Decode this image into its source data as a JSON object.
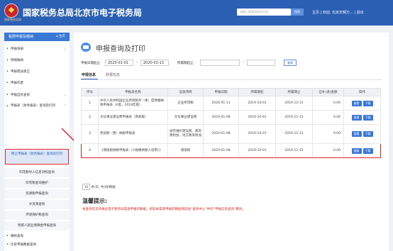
{
  "header": {
    "logo_caption": "国家税务总局",
    "site_title": "国家税务总局北京市电子税务局",
    "search_placeholder": "请输入需要搜索的内容",
    "search_button": "搜索",
    "top_links": "主页 | 欢迎, 北京天辉万... | 退出"
  },
  "sidebar": {
    "header_title": "税费申报及缴纳",
    "home_label": "主页",
    "items": [
      {
        "label": "申报清册",
        "expandable": true
      },
      {
        "label": "预填报纳",
        "expandable": false
      },
      {
        "label": "申报错误更正",
        "expandable": false
      },
      {
        "label": "申报作废",
        "expandable": false
      },
      {
        "label": "申报自有查询",
        "expandable": true
      },
      {
        "label": "申报表（财务报表）查询及打印",
        "expandable": true
      }
    ],
    "active_sub": "网上申报表（财务报表）查询及打印",
    "subs": [
      "印花税导入信息对照查询",
      "印花税查询维护",
      "资源税申报查询",
      "水资源查询",
      "环境保护税查询",
      "残疾人就业保障金申报查询"
    ],
    "bottom_items": [
      {
        "label": "缴款查询",
        "expandable": false
      },
      {
        "label": "历史申报数据查询",
        "expandable": false
      },
      {
        "label": "申报辅助报表服务",
        "expandable": true
      },
      {
        "label": "车船税",
        "expandable": true
      }
    ]
  },
  "page": {
    "title": "申报查询及打印",
    "filter": {
      "date_label": "申报日期起止:",
      "date_from": "2020-01-01",
      "date_sep": "-",
      "date_to": "2020-02-13",
      "period_label": "所属期起止:",
      "period_from": "",
      "period_to": "",
      "query_button": "查询"
    },
    "tabs": [
      "申报信息",
      "财报信息"
    ],
    "table": {
      "headers": [
        "序号",
        "申报表名称",
        "征收项目",
        "申报日期",
        "所属期起",
        "所属期止",
        "应补(退)金额",
        "操作"
      ],
      "view_label": "查看",
      "download_label": "下载",
      "rows": [
        {
          "no": "1",
          "name": "中华人民共和国企业所得税月（季）度预缴纳税申报表（A类，2018年版）",
          "item": "企业所得税",
          "date": "2020-01-11",
          "from": "2019-10-01",
          "to": "2019-12-31",
          "amount": "0.00"
        },
        {
          "no": "2",
          "name": "文化事业建设费申报表（简易版）",
          "item": "文化事业建设费",
          "date": "2020-01-08",
          "from": "2019-10-01",
          "to": "2019-12-31",
          "amount": "0.00"
        },
        {
          "no": "3",
          "name": "附加税（费）纳税申报表",
          "item": "城市维护建设税、教育费附加、地方教育附加",
          "date": "2020-01-08",
          "from": "2019-10-01",
          "to": "2019-12-31",
          "amount": "0.00"
        },
        {
          "no": "4",
          "name": "《增值税纳税申报表（小规模纳税人适用）》",
          "item": "增值税",
          "date": "2020-01-08",
          "from": "2019-10-01",
          "to": "2019-12-31",
          "amount": "0.00"
        }
      ]
    },
    "pager": {
      "page_size": "10",
      "summary": "条/页, 共4条数据"
    },
    "tips_title": "温馨提示:",
    "tips_text": "本查询仅支持通过电子税务局渠道申报的数据，如非本渠道申报的数据请前往“查询中心”中的“申报信息查询”模块。"
  },
  "colors": {
    "header_blue": "#2b5fb3",
    "highlight_red": "#e02626",
    "button_blue": "#3a78d6"
  }
}
